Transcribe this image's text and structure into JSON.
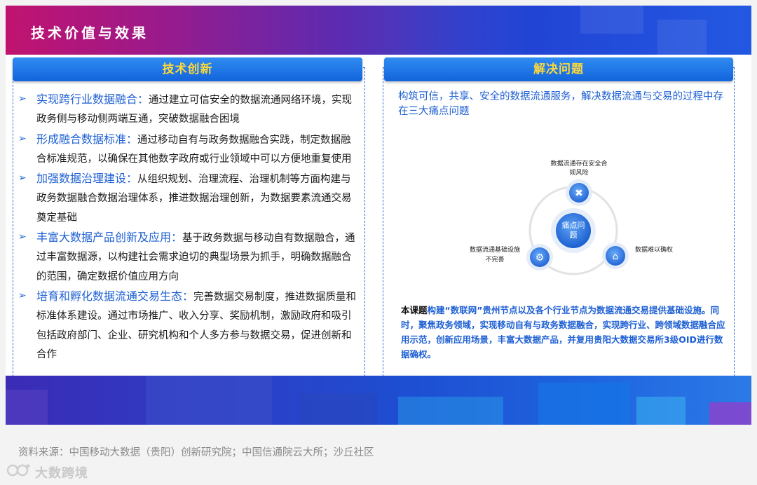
{
  "header": {
    "title": "技术价值与效果"
  },
  "left": {
    "heading": "技术创新",
    "items": [
      {
        "head": "实现跨行业数据融合：",
        "body": "通过建立可信安全的数据流通网络环境，实现政务侧与移动侧两端互通，突破数据融合困境"
      },
      {
        "head": "形成融合数据标准：",
        "body": "通过移动自有与政务数据融合实践，制定数据融合标准规范，以确保在其他数字政府或行业领域中可以方便地重复使用"
      },
      {
        "head": "加强数据治理建设：",
        "body": "从组织规划、治理流程、治理机制等方面构建与政务数据融合数据治理体系，推进数据治理创新，为数据要素流通交易奠定基础"
      },
      {
        "head": "丰富大数据产品创新及应用：",
        "body": "基于政务数据与移动自有数据融合，通过丰富数据源，以构建社会需求迫切的典型场景为抓手，明确数据融合的范围，确定数据价值应用方向"
      },
      {
        "head": "培育和孵化数据流通交易生态：",
        "body": "完善数据交易制度，推进数据质量和标准体系建设。通过市场推广、收入分享、奖励机制，激励政府和吸引包括政府部门、企业、研究机构和个人多方参与数据交易，促进创新和合作"
      }
    ]
  },
  "right": {
    "heading": "解决问题",
    "intro": "构筑可信，共享、安全的数据流通服务，解决数据流通与交易的过程中存在三大痛点问题",
    "diagram": {
      "center": [
        "痛点问",
        "题"
      ],
      "top_label": [
        "数据流通存在安全合",
        "规风险"
      ],
      "right_label": "数据难以确权",
      "left_label": [
        "数据流通基础设施",
        "不完善"
      ]
    },
    "bottom_lead": "本课题",
    "bottom_text": "构建“数联网”贵州节点以及各个行业节点为数据流通交易提供基础设施。同时，聚焦政务领域，实现移动自有与政务数据融合，实现跨行业、跨领域数据融合应用示范，创新应用场景，丰富大数据产品，并复用贵阳大数据交易所3级OID进行数据确权。"
  },
  "source": "资料来源：中国移动大数据（贵阳）创新研究院；中国信通院云大所；沙丘社区",
  "logo": {
    "text": "大数跨境"
  },
  "colors": {
    "accent_blue": "#1d5fd3",
    "bar_text": "#ffd93a"
  }
}
